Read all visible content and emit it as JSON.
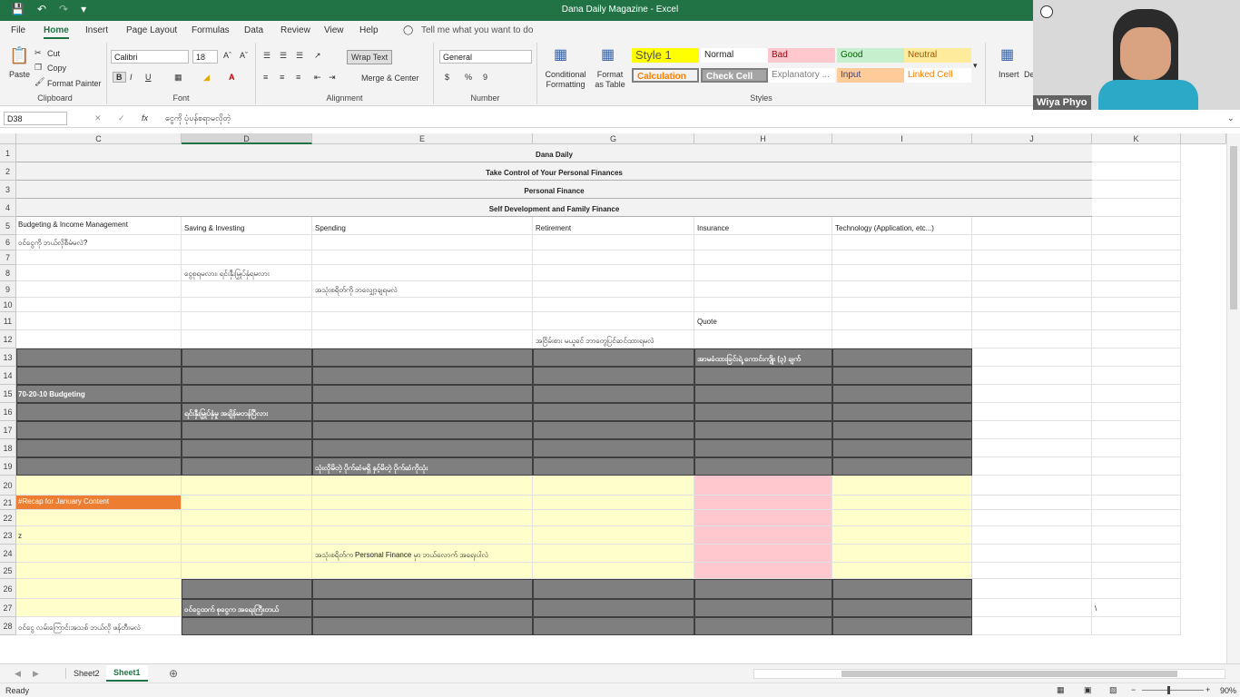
{
  "app": {
    "title": "Dana Daily Magazine  -  Excel"
  },
  "qat": {
    "save_icon": "save-icon",
    "undo_icon": "undo-icon",
    "redo_icon": "redo-icon",
    "customize_icon": "customize-icon"
  },
  "menu": {
    "tabs": [
      "File",
      "Home",
      "Insert",
      "Page Layout",
      "Formulas",
      "Data",
      "Review",
      "View",
      "Help"
    ],
    "tell_me": "Tell me what you want to do"
  },
  "ribbon": {
    "clipboard": {
      "paste": "Paste",
      "cut": "Cut",
      "copy": "Copy",
      "format_painter": "Format Painter",
      "label": "Clipboard"
    },
    "font": {
      "name": "Calibri",
      "size": "18",
      "bold": "B",
      "italic": "I",
      "underline": "U",
      "label": "Font"
    },
    "alignment": {
      "wrap_text": "Wrap Text",
      "merge_center": "Merge & Center",
      "label": "Alignment"
    },
    "number": {
      "format": "General",
      "currency": "$",
      "percent": "%",
      "comma": "9",
      "label": "Number"
    },
    "styles": {
      "conditional_formatting": "Conditional Formatting",
      "format_as_table": "Format as Table",
      "cells": [
        {
          "label": "Style 1",
          "bg": "#ffff00",
          "fg": "#555555"
        },
        {
          "label": "Normal",
          "bg": "#ffffff",
          "fg": "#222222"
        },
        {
          "label": "Bad",
          "bg": "#ffc7ce",
          "fg": "#9c0006"
        },
        {
          "label": "Good",
          "bg": "#c6efce",
          "fg": "#006100"
        },
        {
          "label": "Neutral",
          "bg": "#ffeb9c",
          "fg": "#9c5700"
        },
        {
          "label": "Calculation",
          "bg": "#f2f2f2",
          "fg": "#fa7d00"
        },
        {
          "label": "Check Cell",
          "bg": "#a5a5a5",
          "fg": "#ffffff"
        },
        {
          "label": "Explanatory ...",
          "bg": "#ffffff",
          "fg": "#7f7f7f"
        },
        {
          "label": "Input",
          "bg": "#ffcc99",
          "fg": "#3f3f76"
        },
        {
          "label": "Linked Cell",
          "bg": "#ffffff",
          "fg": "#fa7d00"
        }
      ],
      "label": "Styles"
    },
    "cells": {
      "insert": "Insert",
      "delete": "De"
    }
  },
  "formula_bar": {
    "name_box": "D38",
    "fx": "fx",
    "content": "ငွေကို ပုံပန်စရာမလိုတဲ့"
  },
  "webcam": {
    "name": "Wiya Phyo"
  },
  "grid": {
    "columns": [
      "C",
      "D",
      "E",
      "G",
      "H",
      "I",
      "J",
      "K"
    ],
    "rows": [
      "1",
      "2",
      "3",
      "4",
      "5",
      "6",
      "7",
      "8",
      "9",
      "10",
      "11",
      "12",
      "13",
      "14",
      "15",
      "16",
      "17",
      "18",
      "19",
      "20",
      "21",
      "22",
      "23",
      "24",
      "25",
      "26",
      "27",
      "28"
    ],
    "merged_titles": [
      "Dana Daily",
      "Take Control of Your Personal Finances",
      "Personal Finance",
      "Self Development and Family Finance"
    ],
    "headers": [
      "Budgeting & Income Management",
      "Saving & Investing",
      "Spending",
      "Retirement",
      "Insurance",
      "Technology (Application, etc...)"
    ],
    "cells": {
      "c6": "ဝင်ငွေကို ဘယ်လိုစီမံမလဲ?",
      "d8": "ငွေစုရမလား၊ ရင်းနှီးမြှုပ်နှံရမလား",
      "e9": "အသုံးစရိတ်ကို ဘလျှော့ချရမလဲ",
      "h11": "Quote",
      "g12": "အငြိမ်းစား မယူခင် ဘာတွေပြင်ဆင်ထားရမလဲ",
      "h13": "အာမခံထားခြင်းရဲ့ ကောင်းကျိုး (၃) ချက်",
      "c15": "70-20-10 Budgeting",
      "d16": "ရင်းနှီးမြှုပ်နှံမှု အချိန်မတန်ပြီလား",
      "e19": "သုံးလိုမိတဲ့ ပိုက်ဆံမရှိ နှင့်မိတဲ့ ပိုက်ဆံကိုသုံး",
      "c21": "#Recap for January Content",
      "c23": "z",
      "e24": "အသုံးစရိတ်က Personal Finance မှာ ဘယ်လောက် အရေးပါလဲ",
      "d27": "ဝင်ငွေထက် စုငွေက အရေးကြီးတယ်",
      "c28": "ဝင်ငွေ လမ်းကြောင်းအသစ် ဘယ်လို ဖန်တီးမလဲ",
      "k27": "\\"
    }
  },
  "sheets": {
    "tabs": [
      "Sheet2",
      "Sheet1"
    ],
    "active": "Sheet1"
  },
  "status": {
    "ready": "Ready",
    "zoom": "90%"
  },
  "colors": {
    "excel_green": "#217346",
    "dark_band": "#7f7f7f",
    "yellow_band": "#ffffcc",
    "pink_block": "#ffc7ce",
    "recap_orange": "#ed7d31"
  }
}
